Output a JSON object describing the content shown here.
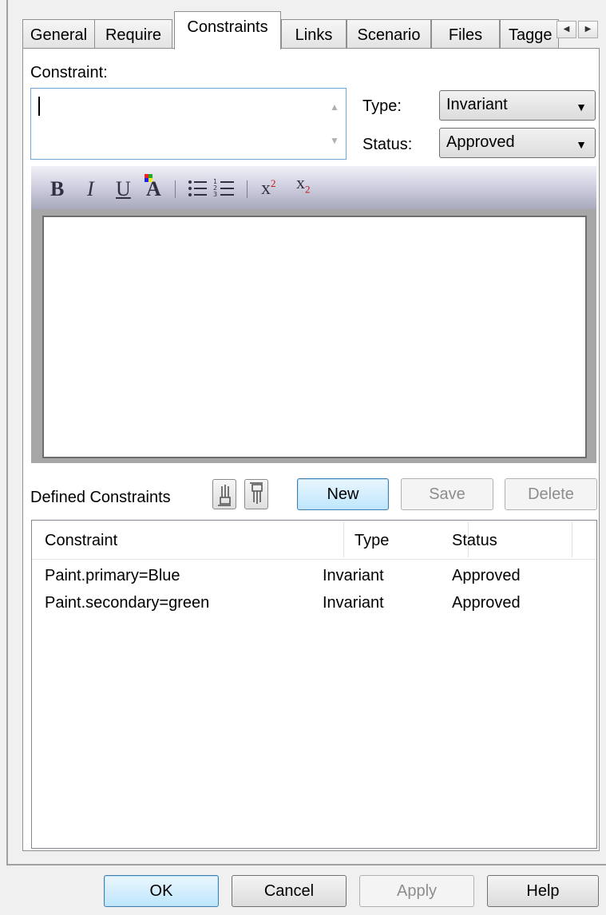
{
  "tabs": [
    {
      "label": "General",
      "active": false
    },
    {
      "label": "Require",
      "active": false
    },
    {
      "label": "Constraints",
      "active": true
    },
    {
      "label": "Links",
      "active": false
    },
    {
      "label": "Scenario",
      "active": false
    },
    {
      "label": "Files",
      "active": false
    },
    {
      "label": "Tagge",
      "active": false
    }
  ],
  "constraint": {
    "label": "Constraint:",
    "value": ""
  },
  "type_field": {
    "label": "Type:",
    "value": "Invariant"
  },
  "status_field": {
    "label": "Status:",
    "value": "Approved"
  },
  "editor_toolbar": {
    "bold": "B",
    "italic": "I",
    "underline": "U",
    "font_color": "A",
    "superscript": "x",
    "superscript_sup": "2",
    "subscript": "x",
    "subscript_sub": "2"
  },
  "defined": {
    "label": "Defined Constraints",
    "new_label": "New",
    "save_label": "Save",
    "delete_label": "Delete"
  },
  "list": {
    "columns": [
      "Constraint",
      "Type",
      "Status"
    ],
    "rows": [
      {
        "constraint": "Paint.primary=Blue",
        "type": "Invariant",
        "status": "Approved"
      },
      {
        "constraint": "Paint.secondary=green",
        "type": "Invariant",
        "status": "Approved"
      }
    ]
  },
  "footer": {
    "ok": "OK",
    "cancel": "Cancel",
    "apply": "Apply",
    "help": "Help"
  }
}
